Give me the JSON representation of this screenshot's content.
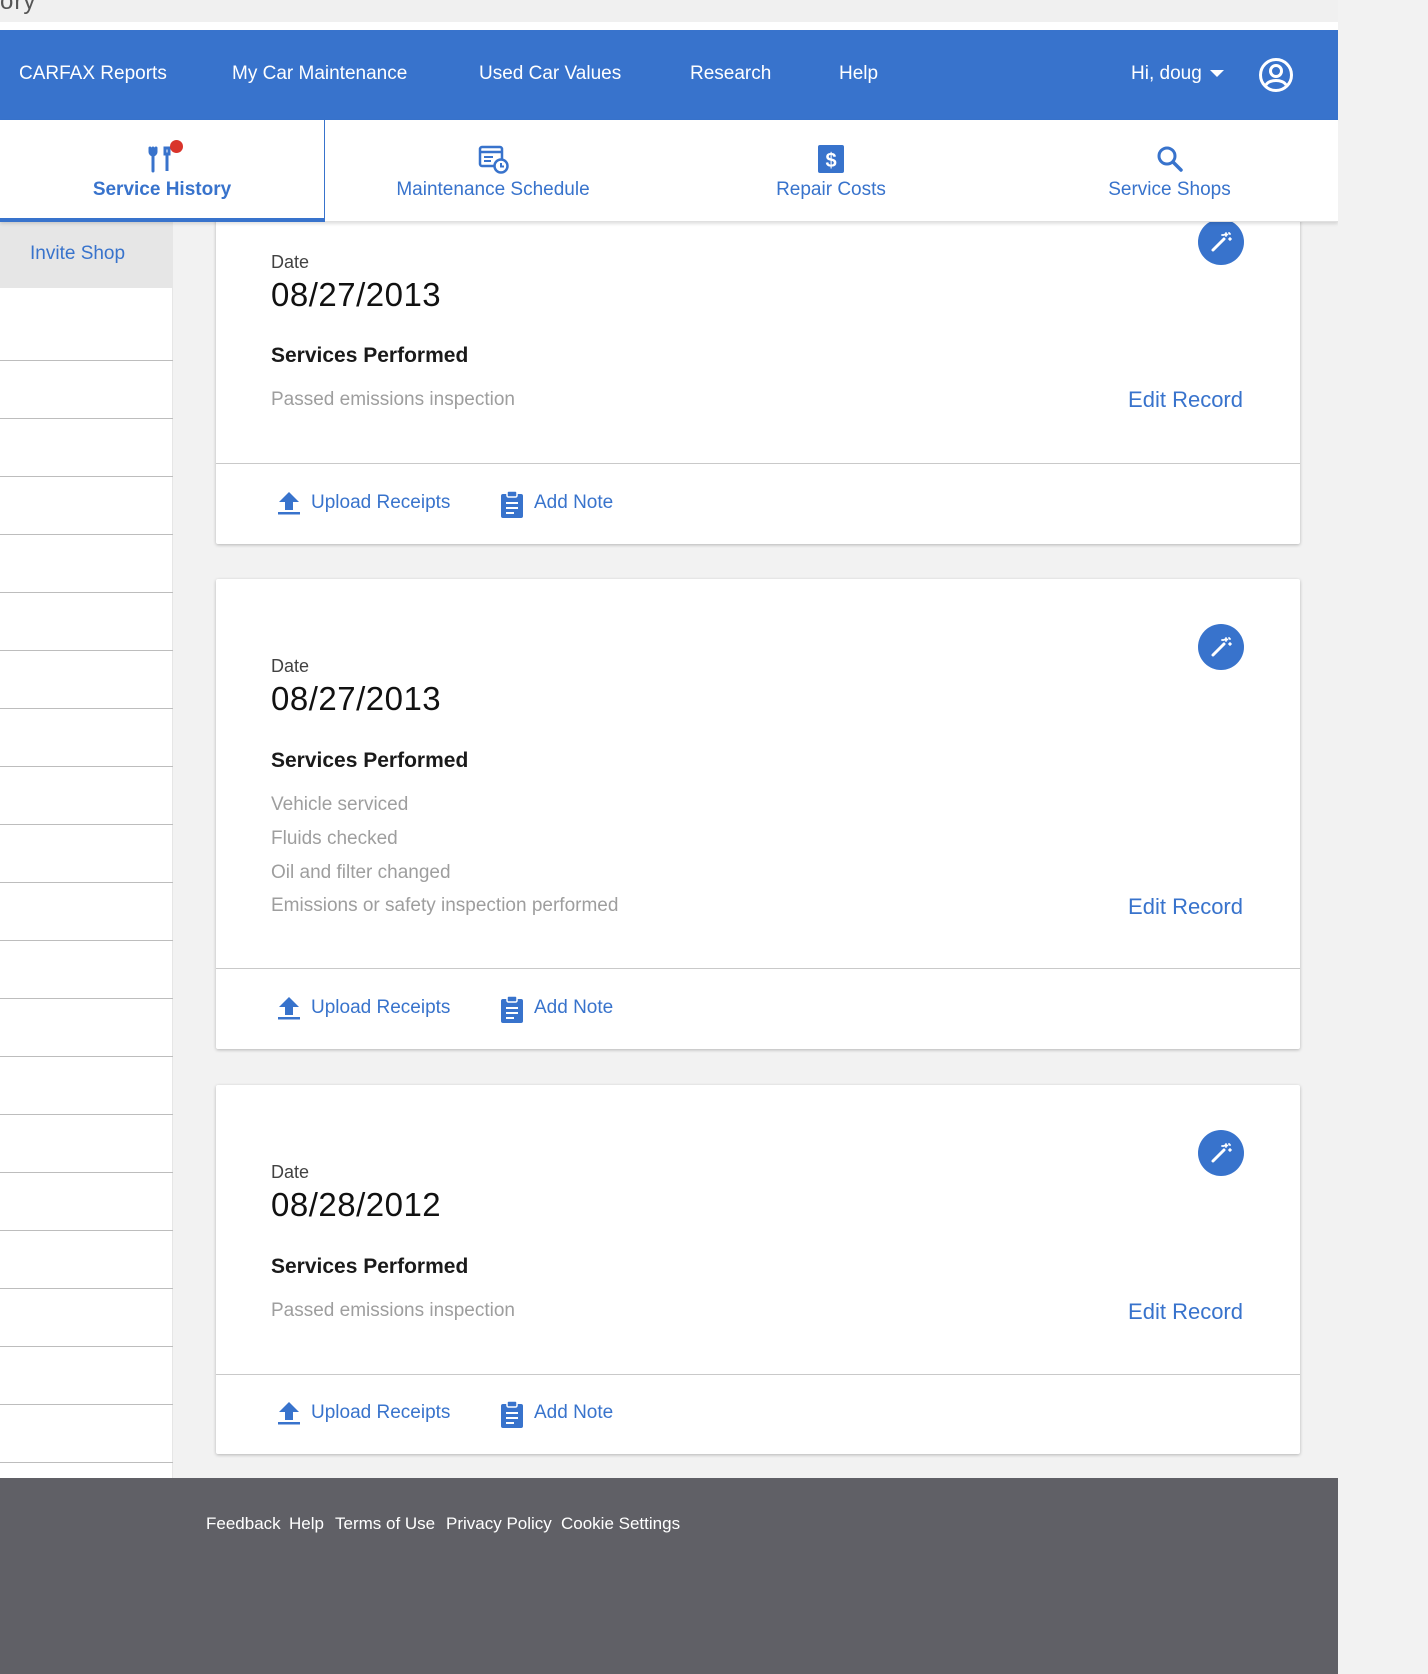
{
  "browser_fragment": "ory",
  "nav": {
    "links": [
      "CARFAX Reports",
      "My Car Maintenance",
      "Used Car Values",
      "Research",
      "Help"
    ],
    "user_greeting": "Hi, doug"
  },
  "tabs": [
    {
      "label": "Service History",
      "icon": "tools-icon",
      "active": true,
      "has_notification": true
    },
    {
      "label": "Maintenance Schedule",
      "icon": "schedule-icon",
      "active": false
    },
    {
      "label": "Repair Costs",
      "icon": "dollar-icon",
      "active": false
    },
    {
      "label": "Service Shops",
      "icon": "search-icon",
      "active": false
    }
  ],
  "sidebar": {
    "invite_shop": "Invite Shop"
  },
  "records": [
    {
      "date_label": "Date",
      "date": "08/27/2013",
      "services_heading": "Services Performed",
      "services": [
        "Passed emissions inspection"
      ],
      "edit_label": "Edit Record",
      "upload_label": "Upload Receipts",
      "note_label": "Add Note"
    },
    {
      "date_label": "Date",
      "date": "08/27/2013",
      "services_heading": "Services Performed",
      "services": [
        "Vehicle serviced",
        "Fluids checked",
        "Oil and filter changed",
        "Emissions or safety inspection performed"
      ],
      "edit_label": "Edit Record",
      "upload_label": "Upload Receipts",
      "note_label": "Add Note"
    },
    {
      "date_label": "Date",
      "date": "08/28/2012",
      "services_heading": "Services Performed",
      "services": [
        "Passed emissions inspection"
      ],
      "edit_label": "Edit Record",
      "upload_label": "Upload Receipts",
      "note_label": "Add Note"
    }
  ],
  "footer": {
    "links": [
      "Feedback",
      "Help",
      "Terms of Use",
      "Privacy Policy",
      "Cookie Settings"
    ]
  },
  "colors": {
    "brand_blue": "#3873cc",
    "notification_red": "#d9342b",
    "footer_gray": "#606066"
  }
}
